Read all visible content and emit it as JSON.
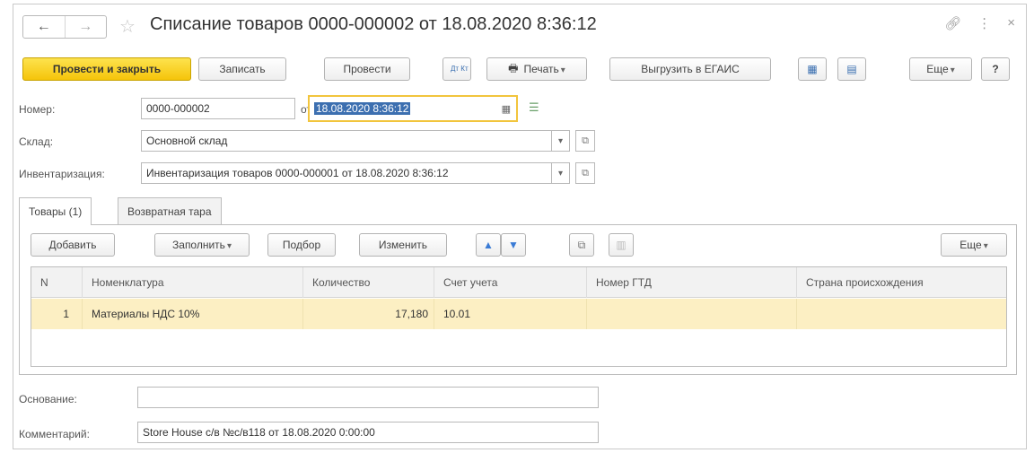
{
  "window": {
    "title": "Списание товаров 0000-000002 от 18.08.2020 8:36:12"
  },
  "toolbar": {
    "post_close": "Провести и закрыть",
    "save": "Записать",
    "post": "Провести",
    "dtkt": "Дт Кт",
    "print": "Печать",
    "upload_egais": "Выгрузить в ЕГАИС",
    "more": "Еще",
    "help": "?"
  },
  "form": {
    "number_label": "Номер:",
    "number_value": "0000-000002",
    "date_label": "от:",
    "date_value": "18.08.2020  8:36:12",
    "warehouse_label": "Склад:",
    "warehouse_value": "Основной склад",
    "inventory_label": "Инвентаризация:",
    "inventory_value": "Инвентаризация товаров 0000-000001 от 18.08.2020 8:36:12",
    "basis_label": "Основание:",
    "basis_value": "",
    "comment_label": "Комментарий:",
    "comment_value": "Store House с/в №с/в118 от 18.08.2020 0:00:00"
  },
  "tabs": [
    {
      "label": "Товары (1)",
      "active": true
    },
    {
      "label": "Возвратная тара",
      "active": false
    }
  ],
  "table_toolbar": {
    "add": "Добавить",
    "fill": "Заполнить",
    "pick": "Подбор",
    "edit": "Изменить",
    "more": "Еще"
  },
  "table": {
    "columns": [
      "N",
      "Номенклатура",
      "Количество",
      "Счет учета",
      "Номер ГТД",
      "Страна происхождения"
    ],
    "rows": [
      {
        "n": "1",
        "item": "Материалы НДС 10%",
        "qty": "17,180",
        "account": "10.01",
        "gtd": "",
        "country": ""
      }
    ]
  },
  "colors": {
    "primary_button": "#f5c40a",
    "selected_row": "#fcefc3",
    "active_field_border": "#f2c53d",
    "selection": "#3c6fb0"
  }
}
